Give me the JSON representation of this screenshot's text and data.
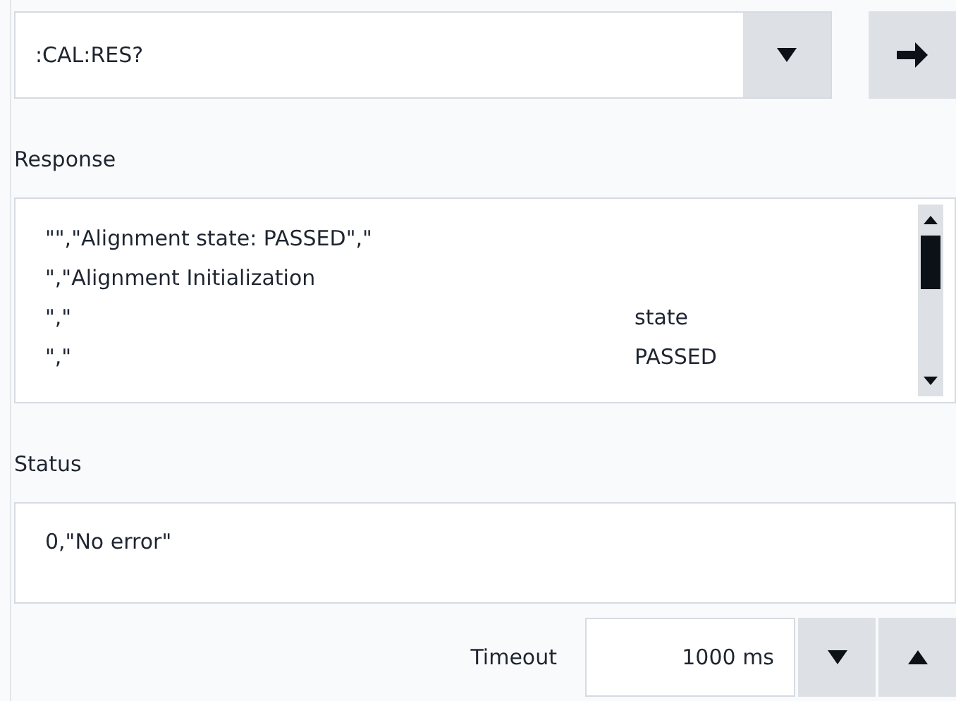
{
  "command": {
    "value": ":CAL:RES?"
  },
  "response": {
    "label": "Response",
    "lines": [
      {
        "text": "\"\",\"Alignment state: PASSED\",\""
      },
      {
        "text": "\",\"Alignment Initialization"
      },
      {
        "text": "\",\"",
        "column_2": "state"
      },
      {
        "text": "\",\"",
        "column_2": "PASSED"
      }
    ]
  },
  "status": {
    "label": "Status",
    "value": "0,\"No error\""
  },
  "timeout": {
    "label": "Timeout",
    "value": "1000 ms"
  }
}
